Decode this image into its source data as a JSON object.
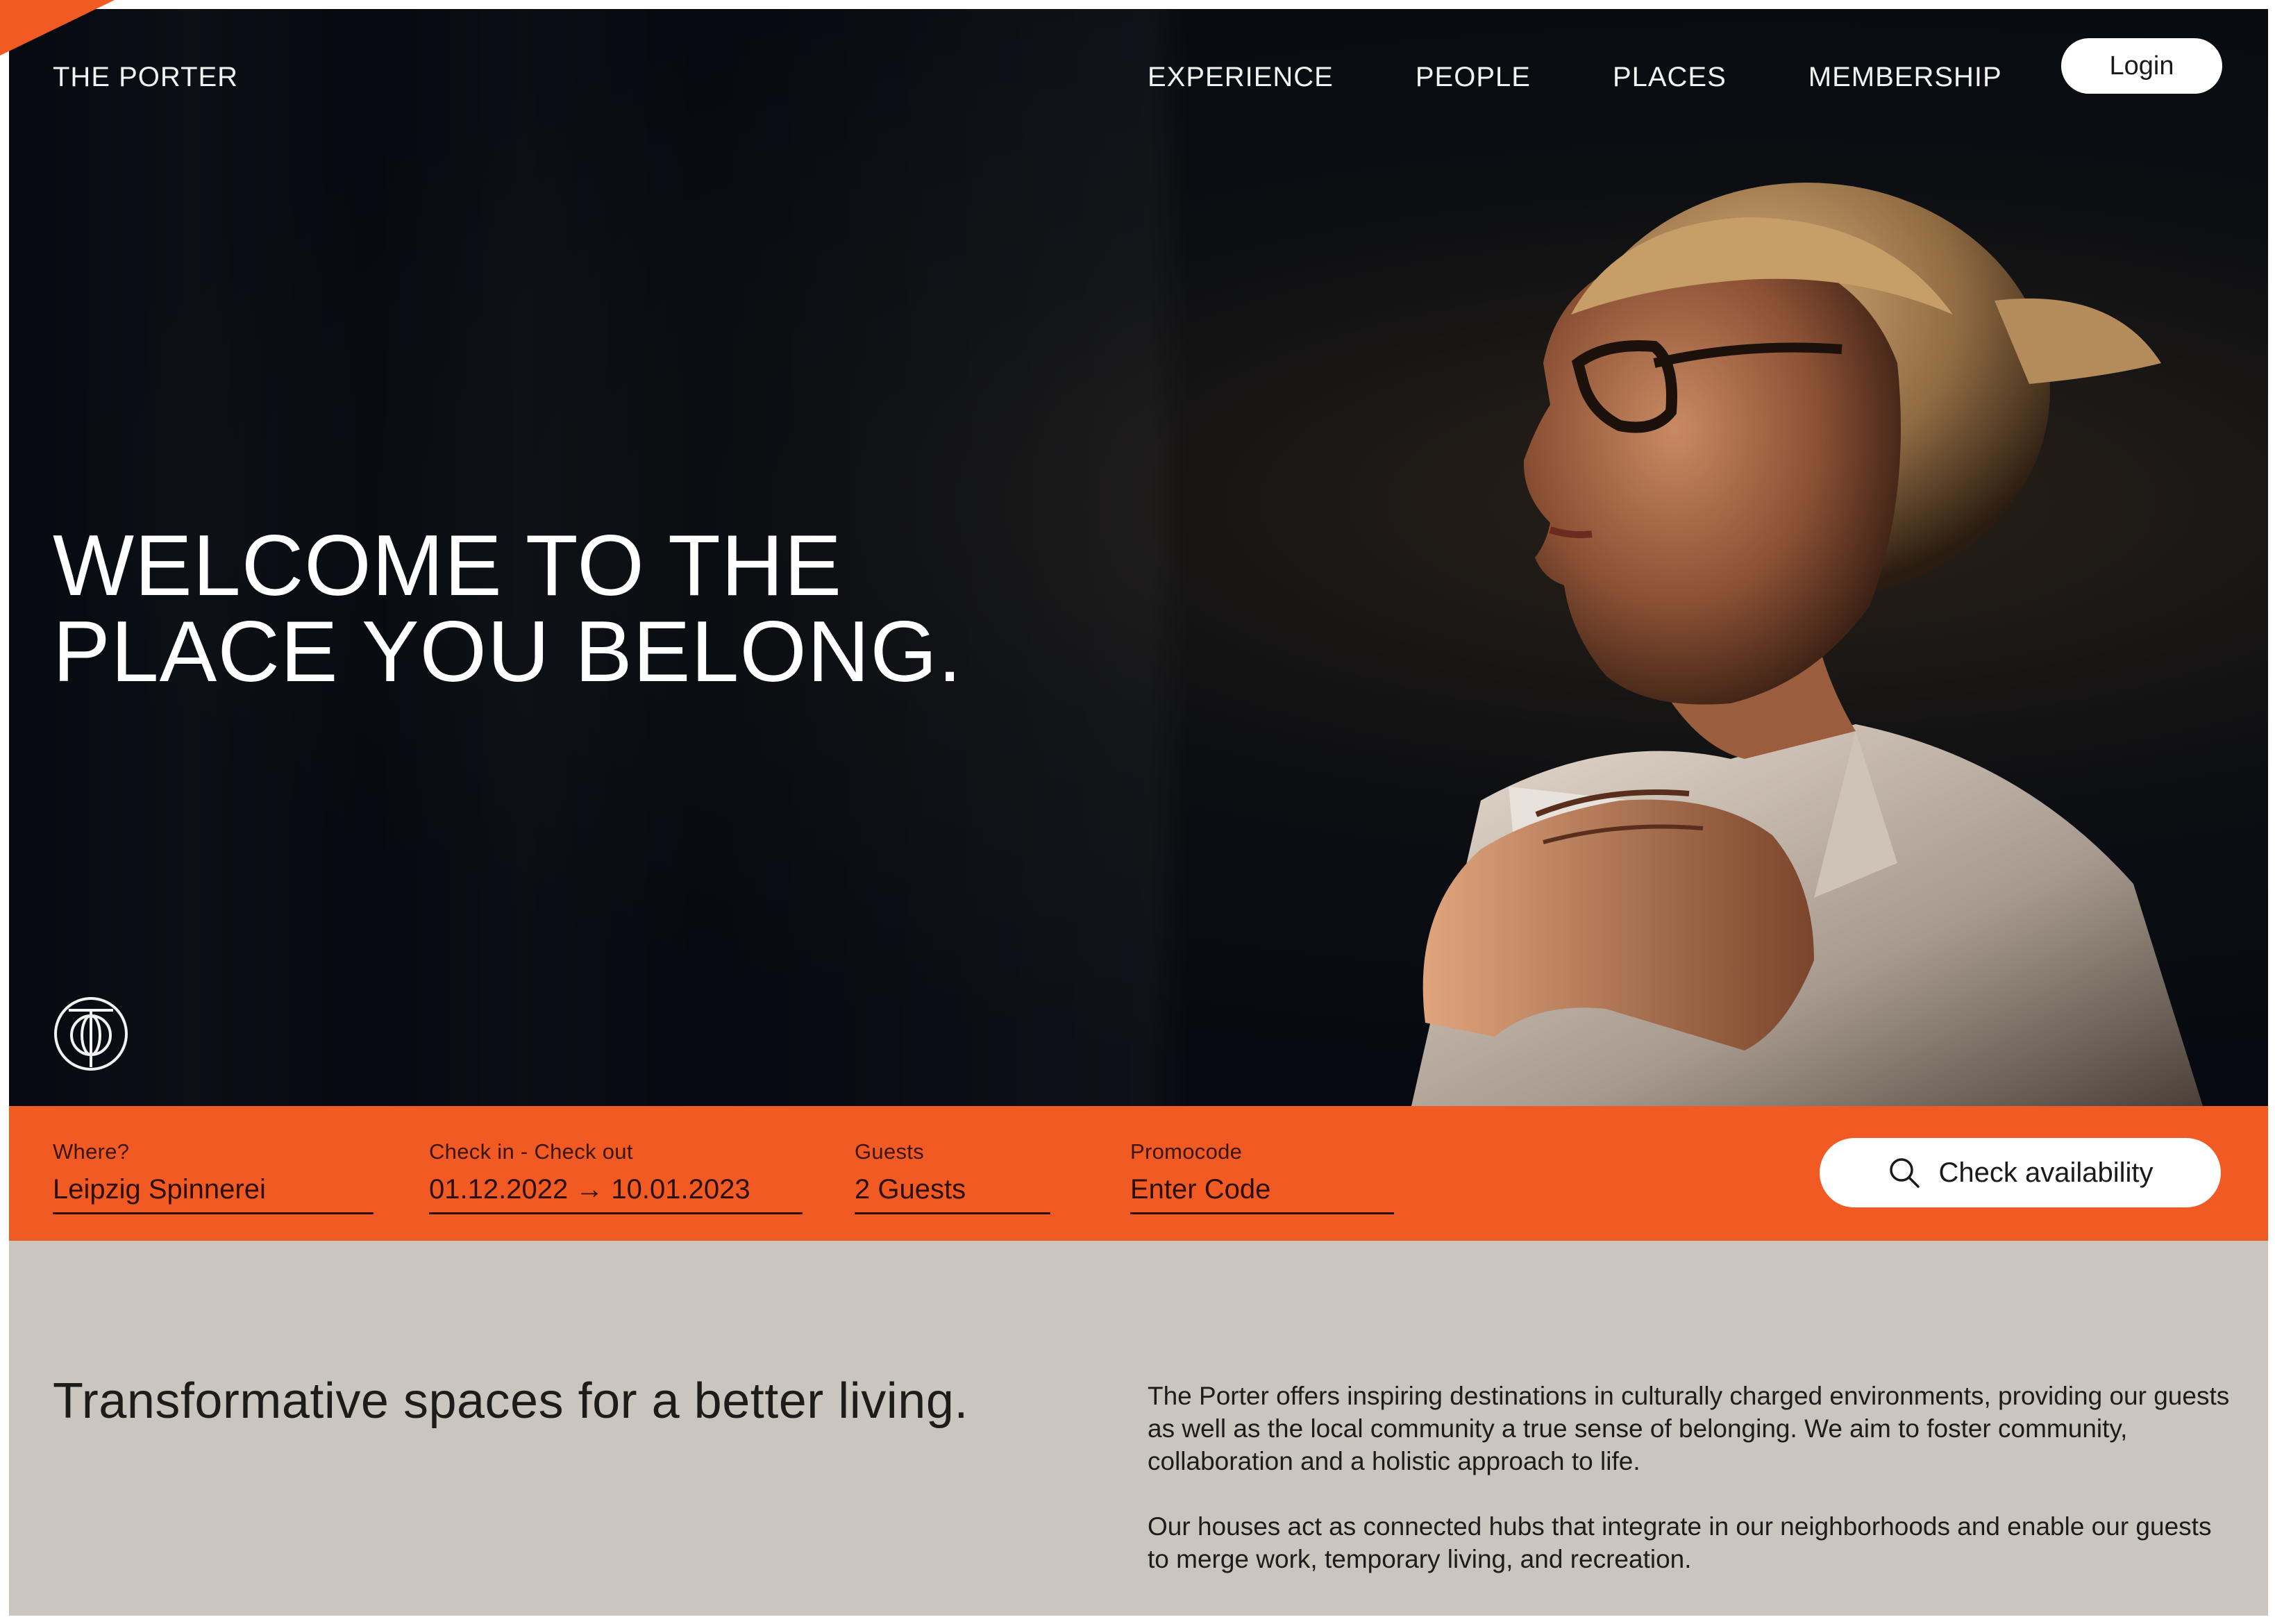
{
  "nav": {
    "brand": "THE PORTER",
    "links": [
      "EXPERIENCE",
      "PEOPLE",
      "PLACES",
      "MEMBERSHIP"
    ],
    "login": "Login"
  },
  "hero": {
    "title_line1": "WELCOME TO THE",
    "title_line2": "PLACE YOU BELONG."
  },
  "booking": {
    "where": {
      "label": "Where?",
      "value": "Leipzig Spinnerei"
    },
    "dates": {
      "label": "Check in - Check out",
      "value": "01.12.2022 → 10.01.2023"
    },
    "guests": {
      "label": "Guests",
      "value": "2 Guests"
    },
    "promo": {
      "label": "Promocode",
      "value": "Enter Code"
    },
    "cta": "Check availability"
  },
  "about": {
    "tagline": "Transformative spaces for a better living.",
    "paragraph1": "The Porter offers inspiring destinations in culturally charged environments, providing our guests as well as the local community a true sense of belonging. We aim to foster community, collaboration and a holistic approach to life.",
    "paragraph2": "Our houses act as connected hubs that integrate in our neighborhoods and enable our guests to merge work, temporary living, and recreation."
  },
  "colors": {
    "accent": "#f15a22",
    "hero_bg": "#060a10",
    "section_bg": "#cbc5bf"
  },
  "icons": [
    "porter-logo-icon",
    "search-icon"
  ]
}
